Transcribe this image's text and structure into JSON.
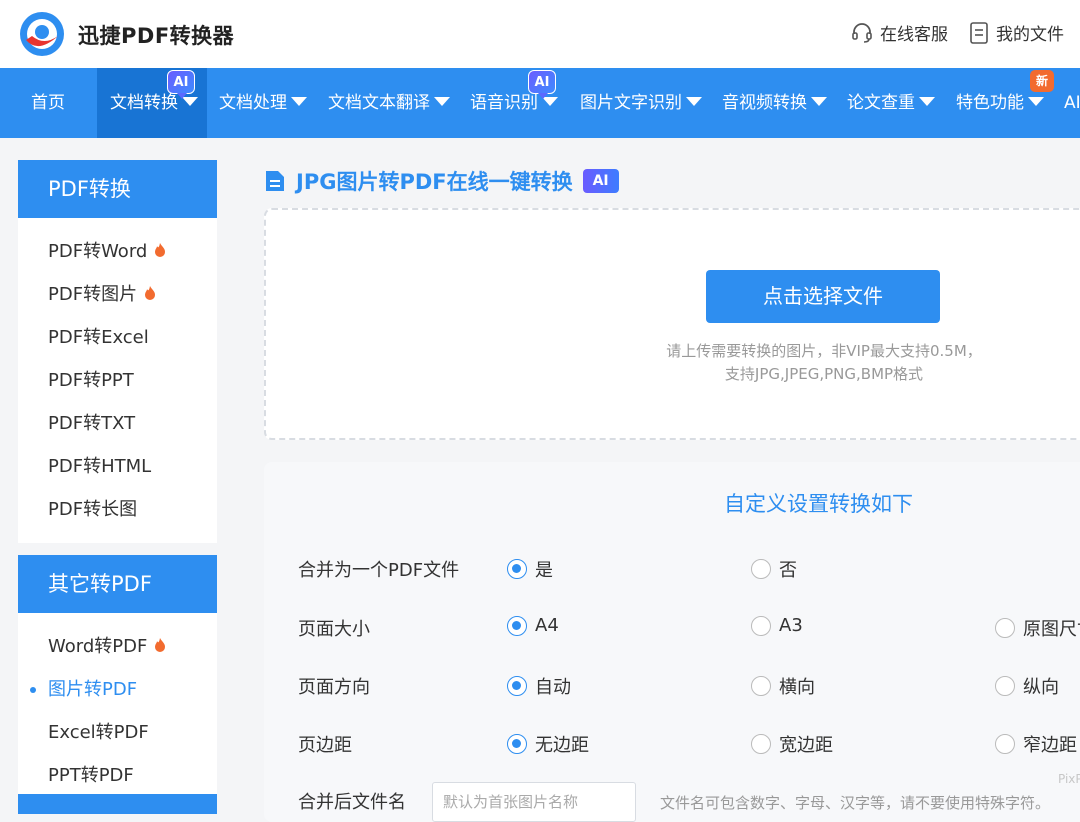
{
  "header": {
    "brand": "迅捷PDF转换器",
    "service_label": "在线客服",
    "files_label": "我的文件"
  },
  "nav": {
    "items": [
      {
        "label": "首页"
      },
      {
        "label": "文档转换",
        "badge": "AI"
      },
      {
        "label": "文档处理"
      },
      {
        "label": "文档文本翻译"
      },
      {
        "label": "语音识别",
        "badge": "AI"
      },
      {
        "label": "图片文字识别"
      },
      {
        "label": "音视频转换"
      },
      {
        "label": "论文查重"
      },
      {
        "label": "特色功能",
        "badge": "新"
      },
      {
        "label": "AI"
      }
    ]
  },
  "sidebar": {
    "group1_title": "PDF转换",
    "group1_items": [
      {
        "label": "PDF转Word",
        "hot": true
      },
      {
        "label": "PDF转图片",
        "hot": true
      },
      {
        "label": "PDF转Excel"
      },
      {
        "label": "PDF转PPT"
      },
      {
        "label": "PDF转TXT"
      },
      {
        "label": "PDF转HTML"
      },
      {
        "label": "PDF转长图"
      }
    ],
    "group2_title": "其它转PDF",
    "group2_items": [
      {
        "label": "Word转PDF",
        "hot": true
      },
      {
        "label": "图片转PDF",
        "active": true
      },
      {
        "label": "Excel转PDF"
      },
      {
        "label": "PPT转PDF"
      }
    ]
  },
  "main": {
    "title": "JPG图片转PDF在线一键转换",
    "ai_tag": "AI",
    "upload_button": "点击选择文件",
    "upload_hint_line1": "请上传需要转换的图片，非VIP最大支持0.5M，",
    "upload_hint_line2": "支持JPG,JPEG,PNG,BMP格式"
  },
  "settings": {
    "title": "自定义设置转换如下",
    "merge": {
      "label": "合并为一个PDF文件",
      "opt1": "是",
      "opt2": "否"
    },
    "page_size": {
      "label": "页面大小",
      "opt1": "A4",
      "opt2": "A3",
      "opt3": "原图尺寸"
    },
    "orientation": {
      "label": "页面方向",
      "opt1": "自动",
      "opt2": "横向",
      "opt3": "纵向"
    },
    "margin": {
      "label": "页边距",
      "opt1": "无边距",
      "opt2": "宽边距",
      "opt3": "窄边距"
    },
    "filename": {
      "label": "合并后文件名",
      "placeholder": "默认为首张图片名称",
      "note": "文件名可包含数字、字母、汉字等，请不要使用特殊字符。"
    }
  },
  "watermark": "PixP",
  "colors": {
    "accent": "#2e8ef0",
    "nav_active": "#1874d4",
    "hot": "#f26b2f"
  }
}
